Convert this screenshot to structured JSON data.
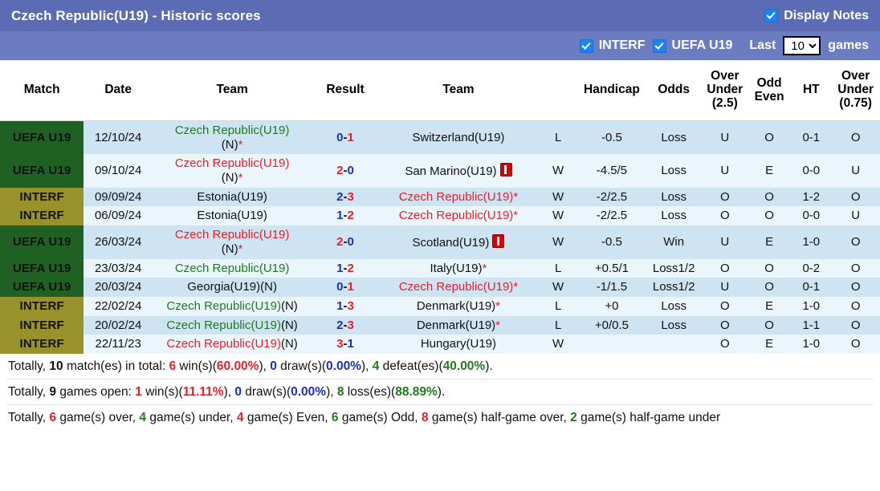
{
  "header": {
    "title": "Czech Republic(U19) - Historic scores",
    "display_notes_label": "Display Notes",
    "display_notes_checked": true,
    "interf_label": "INTERF",
    "interf_checked": true,
    "uefa_label": "UEFA U19",
    "uefa_checked": true,
    "last_label": "Last",
    "games_label": "games",
    "last_count_value": "10",
    "last_count_options": [
      "10"
    ]
  },
  "colors": {
    "titlebar": "#5b6cb5",
    "filterbar": "#6c7cc0",
    "badge_uefa": "#1f6123",
    "badge_interf": "#99922b",
    "row_odd": "#cfe4f3",
    "row_even": "#eaf6fc",
    "green": "#1f7a1f",
    "red": "#ee1c25",
    "blue": "#1a2fbe",
    "checkbox_blue": "#1a84f0"
  },
  "table": {
    "columns": [
      "Match",
      "Date",
      "Team",
      "Result",
      "Team",
      "Handicap",
      "Odds",
      "Over Under (2.5)",
      "Odd Even",
      "HT",
      "Over Under (0.75)"
    ],
    "columns_multiline": {
      "ou25_l1": "Over",
      "ou25_l2": "Under",
      "ou25_l3": "(2.5)",
      "oe_l1": "Odd",
      "oe_l2": "Even",
      "ou075_l1": "Over",
      "ou075_l2": "Under",
      "ou075_l3": "(0.75)"
    },
    "rows": [
      {
        "match": "UEFA U19",
        "match_type": "uefa",
        "date": "12/10/24",
        "home_team": "Czech Republic(U19)",
        "home_suffix": "(N)",
        "home_color": "green",
        "home_star": true,
        "home_redcard": false,
        "home_two_line": true,
        "score_home": "0",
        "score_home_color": "blue",
        "score_away": "1",
        "score_away_color": "red",
        "away_team": "Switzerland(U19)",
        "away_suffix": "",
        "away_color": "black",
        "away_star": false,
        "away_redcard": false,
        "result": "L",
        "result_color": "green",
        "handicap": "-0.5",
        "handicap_color": "blue",
        "odds": "Loss",
        "odds_color": "green",
        "ou25": "U",
        "ou25_color": "green",
        "oddeven": "O",
        "oddeven_color": "green",
        "ht": "0-1",
        "ht_color": "black",
        "ou075": "O",
        "ou075_color": "red"
      },
      {
        "match": "UEFA U19",
        "match_type": "uefa",
        "date": "09/10/24",
        "home_team": "Czech Republic(U19)",
        "home_suffix": "(N)",
        "home_color": "red",
        "home_star": true,
        "home_redcard": false,
        "home_two_line": true,
        "score_home": "2",
        "score_home_color": "red",
        "score_away": "0",
        "score_away_color": "blue",
        "away_team": "San Marino(U19)",
        "away_suffix": "",
        "away_color": "black",
        "away_star": false,
        "away_redcard": true,
        "result": "W",
        "result_color": "red",
        "handicap": "-4.5/5",
        "handicap_color": "blue",
        "odds": "Loss",
        "odds_color": "green",
        "ou25": "U",
        "ou25_color": "green",
        "oddeven": "E",
        "oddeven_color": "red",
        "ht": "0-0",
        "ht_color": "black",
        "ou075": "U",
        "ou075_color": "green"
      },
      {
        "match": "INTERF",
        "match_type": "interf",
        "date": "09/09/24",
        "home_team": "Estonia(U19)",
        "home_suffix": "",
        "home_color": "black",
        "home_star": false,
        "home_redcard": false,
        "home_two_line": false,
        "score_home": "2",
        "score_home_color": "blue",
        "score_away": "3",
        "score_away_color": "red",
        "away_team": "Czech Republic(U19)",
        "away_suffix": "",
        "away_color": "red",
        "away_star": true,
        "away_redcard": false,
        "result": "W",
        "result_color": "red",
        "handicap": "-2/2.5",
        "handicap_color": "black",
        "odds": "Loss",
        "odds_color": "green",
        "ou25": "O",
        "ou25_color": "red",
        "oddeven": "O",
        "oddeven_color": "green",
        "ht": "1-2",
        "ht_color": "black",
        "ou075": "O",
        "ou075_color": "red"
      },
      {
        "match": "INTERF",
        "match_type": "interf",
        "date": "06/09/24",
        "home_team": "Estonia(U19)",
        "home_suffix": "",
        "home_color": "black",
        "home_star": false,
        "home_redcard": false,
        "home_two_line": false,
        "score_home": "1",
        "score_home_color": "blue",
        "score_away": "2",
        "score_away_color": "red",
        "away_team": "Czech Republic(U19)",
        "away_suffix": "",
        "away_color": "red",
        "away_star": true,
        "away_redcard": false,
        "result": "W",
        "result_color": "red",
        "handicap": "-2/2.5",
        "handicap_color": "black",
        "odds": "Loss",
        "odds_color": "green",
        "ou25": "O",
        "ou25_color": "red",
        "oddeven": "O",
        "oddeven_color": "green",
        "ht": "0-0",
        "ht_color": "black",
        "ou075": "U",
        "ou075_color": "green"
      },
      {
        "match": "UEFA U19",
        "match_type": "uefa",
        "date": "26/03/24",
        "home_team": "Czech Republic(U19)",
        "home_suffix": "(N)",
        "home_color": "red",
        "home_star": true,
        "home_redcard": false,
        "home_two_line": true,
        "score_home": "2",
        "score_home_color": "red",
        "score_away": "0",
        "score_away_color": "blue",
        "away_team": "Scotland(U19)",
        "away_suffix": "",
        "away_color": "black",
        "away_star": false,
        "away_redcard": true,
        "result": "W",
        "result_color": "red",
        "handicap": "-0.5",
        "handicap_color": "blue",
        "odds": "Win",
        "odds_color": "red",
        "ou25": "U",
        "ou25_color": "green",
        "oddeven": "E",
        "oddeven_color": "red",
        "ht": "1-0",
        "ht_color": "black",
        "ou075": "O",
        "ou075_color": "red"
      },
      {
        "match": "UEFA U19",
        "match_type": "uefa",
        "date": "23/03/24",
        "home_team": "Czech Republic(U19)",
        "home_suffix": "",
        "home_color": "green",
        "home_star": false,
        "home_redcard": false,
        "home_two_line": false,
        "score_home": "1",
        "score_home_color": "blue",
        "score_away": "2",
        "score_away_color": "red",
        "away_team": "Italy(U19)",
        "away_suffix": "",
        "away_color": "black",
        "away_star": true,
        "away_redcard": false,
        "result": "L",
        "result_color": "green",
        "handicap": "+0.5/1",
        "handicap_color": "blue",
        "odds": "Loss1/2",
        "odds_color": "green",
        "ou25": "O",
        "ou25_color": "red",
        "oddeven": "O",
        "oddeven_color": "green",
        "ht": "0-2",
        "ht_color": "black",
        "ou075": "O",
        "ou075_color": "red"
      },
      {
        "match": "UEFA U19",
        "match_type": "uefa",
        "date": "20/03/24",
        "home_team": "Georgia(U19)",
        "home_suffix": "(N)",
        "home_color": "black",
        "home_star": false,
        "home_redcard": false,
        "home_two_line": false,
        "score_home": "0",
        "score_home_color": "blue",
        "score_away": "1",
        "score_away_color": "red",
        "away_team": "Czech Republic(U19)",
        "away_suffix": "",
        "away_color": "red",
        "away_star": true,
        "away_redcard": false,
        "result": "W",
        "result_color": "red",
        "handicap": "-1/1.5",
        "handicap_color": "blue",
        "odds": "Loss1/2",
        "odds_color": "green",
        "ou25": "U",
        "ou25_color": "green",
        "oddeven": "O",
        "oddeven_color": "green",
        "ht": "0-1",
        "ht_color": "black",
        "ou075": "O",
        "ou075_color": "red"
      },
      {
        "match": "INTERF",
        "match_type": "interf",
        "date": "22/02/24",
        "home_team": "Czech Republic(U19)",
        "home_suffix": "(N)",
        "home_color": "green",
        "home_star": false,
        "home_redcard": false,
        "home_two_line": false,
        "score_home": "1",
        "score_home_color": "blue",
        "score_away": "3",
        "score_away_color": "red",
        "away_team": "Denmark(U19)",
        "away_suffix": "",
        "away_color": "black",
        "away_star": true,
        "away_redcard": false,
        "result": "L",
        "result_color": "green",
        "handicap": "+0",
        "handicap_color": "black",
        "odds": "Loss",
        "odds_color": "green",
        "ou25": "O",
        "ou25_color": "red",
        "oddeven": "E",
        "oddeven_color": "red",
        "ht": "1-0",
        "ht_color": "black",
        "ou075": "O",
        "ou075_color": "red"
      },
      {
        "match": "INTERF",
        "match_type": "interf",
        "date": "20/02/24",
        "home_team": "Czech Republic(U19)",
        "home_suffix": "(N)",
        "home_color": "green",
        "home_star": false,
        "home_redcard": false,
        "home_two_line": false,
        "score_home": "2",
        "score_home_color": "blue",
        "score_away": "3",
        "score_away_color": "red",
        "away_team": "Denmark(U19)",
        "away_suffix": "",
        "away_color": "black",
        "away_star": true,
        "away_redcard": false,
        "result": "L",
        "result_color": "green",
        "handicap": "+0/0.5",
        "handicap_color": "black",
        "odds": "Loss",
        "odds_color": "green",
        "ou25": "O",
        "ou25_color": "red",
        "oddeven": "O",
        "oddeven_color": "green",
        "ht": "1-1",
        "ht_color": "black",
        "ou075": "O",
        "ou075_color": "red"
      },
      {
        "match": "INTERF",
        "match_type": "interf",
        "date": "22/11/23",
        "home_team": "Czech Republic(U19)",
        "home_suffix": "(N)",
        "home_color": "red",
        "home_star": false,
        "home_redcard": false,
        "home_two_line": false,
        "score_home": "3",
        "score_home_color": "red",
        "score_away": "1",
        "score_away_color": "blue",
        "away_team": "Hungary(U19)",
        "away_suffix": "",
        "away_color": "black",
        "away_star": false,
        "away_redcard": false,
        "result": "W",
        "result_color": "red",
        "handicap": "",
        "handicap_color": "black",
        "odds": "",
        "odds_color": "green",
        "ou25": "O",
        "ou25_color": "red",
        "oddeven": "E",
        "oddeven_color": "red",
        "ht": "1-0",
        "ht_color": "black",
        "ou075": "O",
        "ou075_color": "red"
      }
    ]
  },
  "footer": {
    "line1": {
      "p1": "Totally, ",
      "n1": "10",
      "p2": " match(es) in total: ",
      "n2": "6",
      "p3": " win(s)(",
      "n3": "60.00%",
      "p4": "), ",
      "n4": "0",
      "p5": " draw(s)(",
      "n5": "0.00%",
      "p6": "), ",
      "n6": "4",
      "p7": " defeat(es)(",
      "n7": "40.00%",
      "p8": ")."
    },
    "line2": {
      "p1": "Totally, ",
      "n1": "9",
      "p2": " games open: ",
      "n2": "1",
      "p3": " win(s)(",
      "n3": "11.11%",
      "p4": "), ",
      "n4": "0",
      "p5": " draw(s)(",
      "n5": "0.00%",
      "p6": "), ",
      "n6": "8",
      "p7": " loss(es)(",
      "n7": "88.89%",
      "p8": ")."
    },
    "line3": {
      "p1": "Totally, ",
      "n1": "6",
      "p2": " game(s) over, ",
      "n2": "4",
      "p3": " game(s) under, ",
      "n3": "4",
      "p4": " game(s) Even, ",
      "n4": "6",
      "p5": " game(s) Odd, ",
      "n5": "8",
      "p6": " game(s) half-game over, ",
      "n6": "2",
      "p7": " game(s) half-game under"
    }
  }
}
